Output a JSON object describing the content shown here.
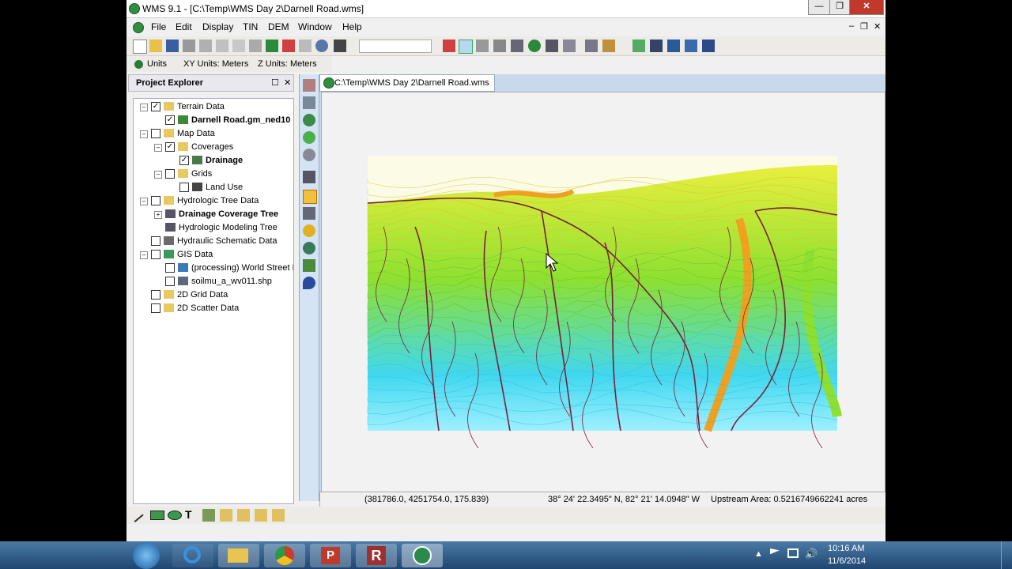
{
  "window": {
    "title": "WMS 9.1 - [C:\\Temp\\WMS Day 2\\Darnell Road.wms]",
    "minimize": "—",
    "restore": "❐",
    "close": "✕"
  },
  "menu": {
    "items": [
      "File",
      "Edit",
      "Display",
      "TIN",
      "DEM",
      "Window",
      "Help"
    ],
    "mdi_min": "–",
    "mdi_restore": "❐",
    "mdi_close": "✕"
  },
  "units": {
    "button": "Units",
    "xy": "XY Units: Meters",
    "z": "Z Units: Meters"
  },
  "panel": {
    "title": "Project Explorer",
    "pin": "☐",
    "close": "✕"
  },
  "tree": [
    {
      "label": "Terrain Data",
      "depth": 0,
      "exp": "–",
      "check": true,
      "bold": false,
      "icon": "folder"
    },
    {
      "label": "Darnell Road.gm_ned10",
      "depth": 1,
      "exp": "",
      "check": true,
      "bold": true,
      "icon": "dem"
    },
    {
      "label": "Map Data",
      "depth": 0,
      "exp": "–",
      "check": false,
      "bold": false,
      "icon": "folder"
    },
    {
      "label": "Coverages",
      "depth": 1,
      "exp": "–",
      "check": true,
      "bold": false,
      "icon": "folder"
    },
    {
      "label": "Drainage",
      "depth": 2,
      "exp": "",
      "check": true,
      "bold": true,
      "icon": "coverage"
    },
    {
      "label": "Grids",
      "depth": 1,
      "exp": "–",
      "check": false,
      "bold": false,
      "icon": "folder"
    },
    {
      "label": "Land Use",
      "depth": 2,
      "exp": "",
      "check": false,
      "bold": false,
      "icon": "grid"
    },
    {
      "label": "Hydrologic Tree Data",
      "depth": 0,
      "exp": "–",
      "check": false,
      "bold": false,
      "icon": "folder"
    },
    {
      "label": "Drainage Coverage Tree",
      "depth": 1,
      "exp": "+",
      "check": null,
      "bold": true,
      "icon": "tree"
    },
    {
      "label": "Hydrologic Modeling Tree",
      "depth": 1,
      "exp": "",
      "check": null,
      "bold": false,
      "icon": "tree"
    },
    {
      "label": "Hydraulic Schematic Data",
      "depth": 0,
      "exp": "",
      "check": false,
      "bold": false,
      "icon": "schematic"
    },
    {
      "label": "GIS Data",
      "depth": 0,
      "exp": "–",
      "check": false,
      "bold": false,
      "icon": "gis"
    },
    {
      "label": "(processing) World Street Ma",
      "depth": 1,
      "exp": "",
      "check": false,
      "bold": false,
      "icon": "globe"
    },
    {
      "label": "soilmu_a_wv011.shp",
      "depth": 1,
      "exp": "",
      "check": false,
      "bold": false,
      "icon": "shape"
    },
    {
      "label": "2D Grid Data",
      "depth": 0,
      "exp": "",
      "check": false,
      "bold": false,
      "icon": "folder"
    },
    {
      "label": "2D Scatter Data",
      "depth": 0,
      "exp": "",
      "check": false,
      "bold": false,
      "icon": "folder"
    }
  ],
  "document": {
    "tab": "C:\\Temp\\WMS Day 2\\Darnell Road.wms"
  },
  "status": {
    "coords": "(381786.0, 4251754.0, 175.839)",
    "latlon": "38° 24' 22.3495\" N, 82° 21' 14.0948\" W",
    "upstream": "Upstream Area: 0.5216749662241 acres"
  },
  "taskbar": {
    "time": "10:16 AM",
    "date": "11/6/2014"
  },
  "colors": {
    "low": "#40d8f0",
    "mid": "#8ee030",
    "high": "#f0f040",
    "ridge": "#f0a020",
    "stream": "#7a1f3a"
  },
  "icons": {
    "start": "windows-orb-icon",
    "ie": "internet-explorer-icon",
    "explorer": "folder-icon",
    "chrome": "chrome-icon",
    "ppt": "powerpoint-icon",
    "r": "r-icon",
    "wms": "wms-icon"
  }
}
